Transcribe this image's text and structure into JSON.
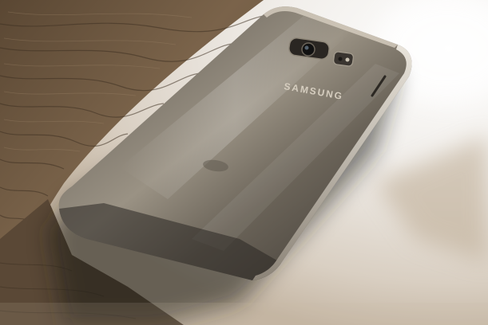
{
  "photo": {
    "brand": "SAMSUNG",
    "subject": "smartphone-back",
    "surface": "wooden-table",
    "colors": {
      "wood_dark": "#4a3a2a",
      "wood_mid": "#6b5640",
      "wood_light": "#8a7258",
      "phone_body": "#6e675c",
      "phone_edge": "#2c2823",
      "phone_highlight": "#b9b1a3",
      "background_light": "#f1efec",
      "background_beige": "#cfc3b3",
      "shadow": "#1e1a15"
    }
  }
}
